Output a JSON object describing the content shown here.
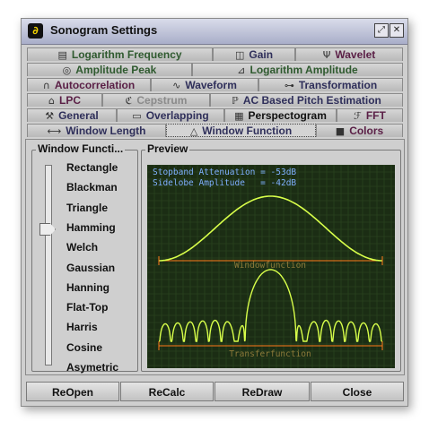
{
  "window": {
    "title": "Sonogram Settings"
  },
  "tabs": {
    "row1": [
      {
        "label": "Logarithm Frequency",
        "icon": "log-frequency-icon",
        "color": "#2f5a2f"
      },
      {
        "label": "Gain",
        "icon": "gain-icon",
        "color": "#2f2f5a"
      },
      {
        "label": "Wavelet",
        "icon": "wavelet-icon",
        "color": "#5a1f46"
      }
    ],
    "row2": [
      {
        "label": "Amplitude Peak",
        "icon": "amplitude-peak-icon",
        "color": "#2f5a2f"
      },
      {
        "label": "Logarithm Amplitude",
        "icon": "log-amplitude-icon",
        "color": "#2f5a2f"
      }
    ],
    "row3": [
      {
        "label": "Autocorrelation",
        "icon": "autocorrelation-icon",
        "color": "#5a1f46"
      },
      {
        "label": "Waveform",
        "icon": "waveform-icon",
        "color": "#2f2f5a"
      },
      {
        "label": "Transformation",
        "icon": "transformation-icon",
        "color": "#2f2f5a"
      }
    ],
    "row4": [
      {
        "label": "LPC",
        "icon": "lpc-icon",
        "color": "#5a1f46"
      },
      {
        "label": "Cepstrum",
        "icon": "cepstrum-icon",
        "color": "#8a8a8a"
      },
      {
        "label": "AC Based Pitch Estimation",
        "icon": "pitch-estimation-icon",
        "color": "#2f2f5a"
      }
    ],
    "row5": [
      {
        "label": "General",
        "icon": "general-icon",
        "color": "#2f2f5a"
      },
      {
        "label": "Overlapping",
        "icon": "overlapping-icon",
        "color": "#2f2f5a"
      },
      {
        "label": "Perspectogram",
        "icon": "perspectogram-icon",
        "color": "#111111"
      },
      {
        "label": "FFT",
        "icon": "fft-icon",
        "color": "#5a1f46"
      }
    ],
    "row6": [
      {
        "label": "Window Length",
        "icon": "window-length-icon",
        "color": "#2f2f5a"
      },
      {
        "label": "Window Function",
        "icon": "window-function-icon",
        "color": "#2f2f5a",
        "active": true
      },
      {
        "label": "Colors",
        "icon": "colors-icon",
        "color": "#5a1f46"
      }
    ]
  },
  "window_function": {
    "title": "Window Functi...",
    "selected": "Hamming",
    "options": [
      "Rectangle",
      "Blackman",
      "Triangle",
      "Hamming",
      "Welch",
      "Gaussian",
      "Hanning",
      "Flat-Top",
      "Harris",
      "Cosine",
      "Asymetric"
    ]
  },
  "preview": {
    "title": "Preview",
    "info_line1": "Stopband Attenuation = -53dB",
    "info_line2": "Sidelobe Amplitude   = -42dB",
    "label_window": "Windowfunction",
    "label_transfer": "Transferfunction",
    "colors": {
      "background": "#1b2d14",
      "grid": "#2f4a22",
      "curve": "#d8ff4a",
      "baseline": "#ff7a1a",
      "text": "#7fb0ff",
      "label": "#8c7a3a"
    }
  },
  "buttons": {
    "reopen": "ReOpen",
    "recalc": "ReCalc",
    "redraw": "ReDraw",
    "close": "Close"
  }
}
